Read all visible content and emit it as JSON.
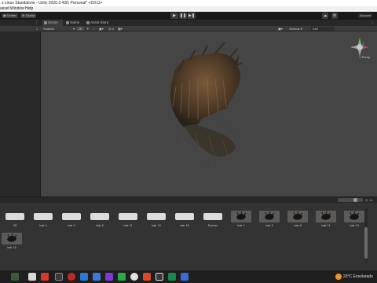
{
  "window": {
    "title": "s Linux Standalone - Unity 2020.3.43f1 Personal* <DX11>"
  },
  "menu": [
    "asset",
    "Window",
    "Help"
  ],
  "toolbar": {
    "center_label": "Center",
    "global_label": "Global",
    "account_label": "Account"
  },
  "tabs": [
    {
      "label": "Scene",
      "active": true
    },
    {
      "label": "Game",
      "active": false
    },
    {
      "label": "Asset Store",
      "active": false
    }
  ],
  "scene": {
    "shading_mode": "Shaded",
    "dim_toggle": "2D",
    "gizmos_label": "Gizmos",
    "all_label": "All",
    "gizmo_label": "< Persp"
  },
  "assets": [
    {
      "label": "28",
      "thumb": "light"
    },
    {
      "label": "hair 1",
      "thumb": "light"
    },
    {
      "label": "hair 3",
      "thumb": "light"
    },
    {
      "label": "hair 8",
      "thumb": "light"
    },
    {
      "label": "hair 11",
      "thumb": "light"
    },
    {
      "label": "hair 13",
      "thumb": "light"
    },
    {
      "label": "hair 16",
      "thumb": "light"
    },
    {
      "label": "Scenes",
      "thumb": "light"
    },
    {
      "label": "hair 1",
      "thumb": "hair"
    },
    {
      "label": "hair 3",
      "thumb": "hair"
    },
    {
      "label": "hair 8",
      "thumb": "hair"
    },
    {
      "label": "hair 11",
      "thumb": "hair"
    },
    {
      "label": "hair 13",
      "thumb": "hair"
    },
    {
      "label": "hair 16",
      "thumb": "hair"
    }
  ],
  "project_slider_count": "14",
  "taskbar": {
    "weather": "23°C Ensolarado"
  }
}
